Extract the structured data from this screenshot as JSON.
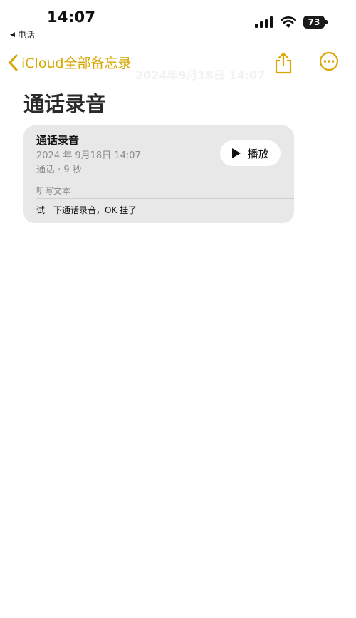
{
  "status": {
    "time": "14:07",
    "back_app": "电话",
    "battery": "73",
    "icons": [
      "cellular-signal-icon",
      "wifi-icon",
      "battery-icon"
    ]
  },
  "nav": {
    "back_label": "iCloud全部备忘录",
    "ghost_title": "2024年9月18日 14:07",
    "accent_color": "#d9a600"
  },
  "note": {
    "title": "通话录音"
  },
  "recording": {
    "title": "通话录音",
    "date": "2024 年 9月18日 14:07",
    "meta": "通话 · 9 秒",
    "play_label": "播放",
    "transcript_label": "听写文本",
    "transcript": "试一下通话录音，OK 挂了"
  }
}
